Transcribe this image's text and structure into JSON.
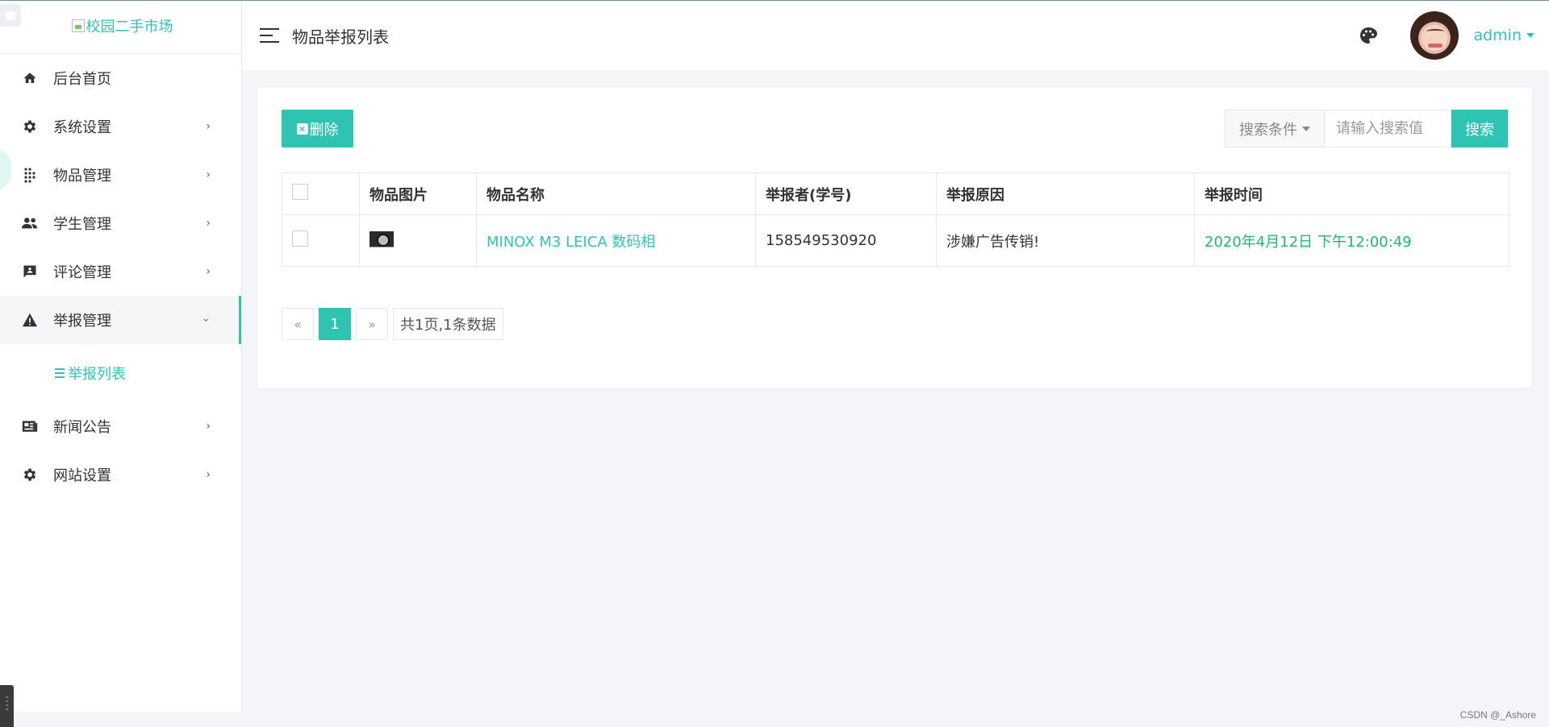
{
  "logo": {
    "alt_text": "校园二手市场"
  },
  "sidebar": {
    "items": [
      {
        "label": "后台首页",
        "icon": "home-icon",
        "has_children": false
      },
      {
        "label": "系统设置",
        "icon": "gear-icon",
        "has_children": true
      },
      {
        "label": "物品管理",
        "icon": "grid-dots-icon",
        "has_children": true
      },
      {
        "label": "学生管理",
        "icon": "people-icon",
        "has_children": true
      },
      {
        "label": "评论管理",
        "icon": "comment-icon",
        "has_children": true
      },
      {
        "label": "举报管理",
        "icon": "warning-icon",
        "has_children": true,
        "expanded": true
      },
      {
        "label": "新闻公告",
        "icon": "news-icon",
        "has_children": true
      },
      {
        "label": "网站设置",
        "icon": "gear-icon",
        "has_children": true
      }
    ],
    "active_submenu": {
      "label": "举报列表",
      "icon": "list-icon"
    }
  },
  "header": {
    "title": "物品举报列表",
    "user_name": "admin"
  },
  "toolbar": {
    "delete_label": "删除",
    "search_condition_label": "搜索条件",
    "search_placeholder": "请输入搜索值",
    "search_label": "搜索"
  },
  "table": {
    "columns": [
      "物品图片",
      "物品名称",
      "举报者(学号)",
      "举报原因",
      "举报时间"
    ],
    "rows": [
      {
        "name": "MINOX M3 LEICA 数码相",
        "reporter": "158549530920",
        "reason": "涉嫌广告传销!",
        "time": "2020年4月12日 下午12:00:49"
      }
    ]
  },
  "pagination": {
    "prev": "«",
    "current": "1",
    "next": "»",
    "summary": "共1页,1条数据"
  },
  "watermark": "CSDN @_Ashore",
  "colors": {
    "accent": "#2fc4b2",
    "time": "#1fb96a"
  }
}
